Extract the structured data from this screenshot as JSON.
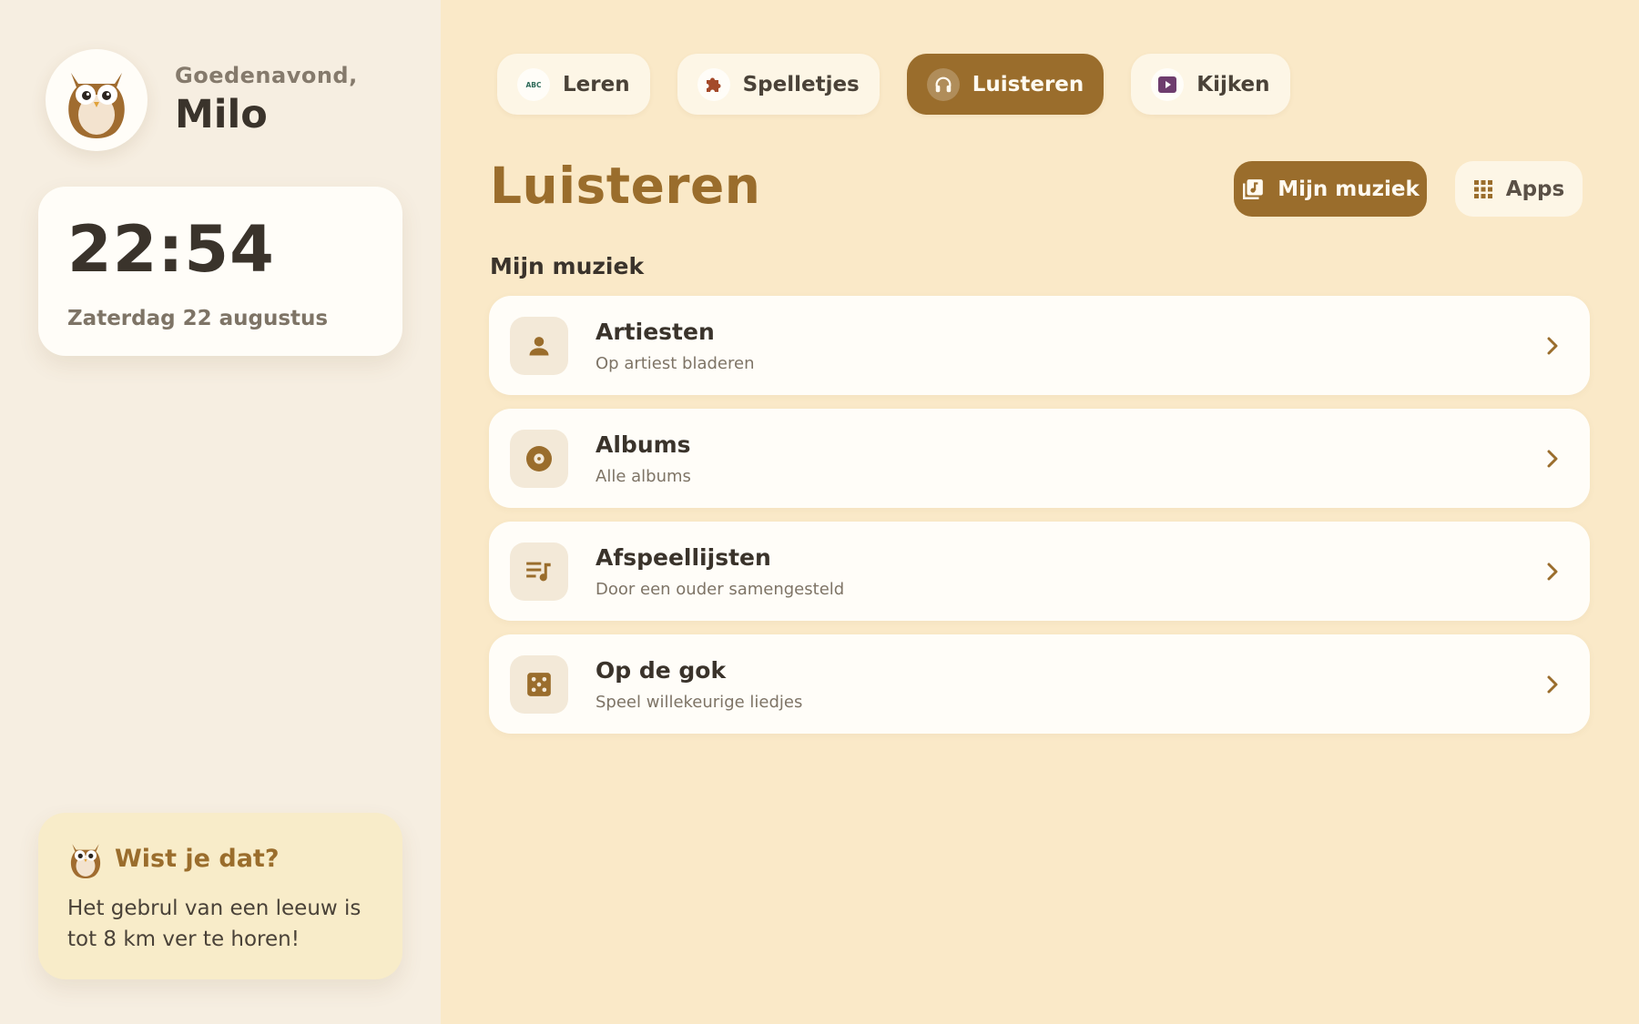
{
  "profile": {
    "greeting": "Goedenavond,",
    "name": "Milo"
  },
  "clock": {
    "time": "22:54",
    "date": "Zaterdag 22 augustus"
  },
  "fact": {
    "title": "Wist je dat?",
    "text": "Het gebrul van een leeuw is tot 8 km ver te horen!"
  },
  "tabs": [
    {
      "label": "Leren",
      "icon": "abc-icon",
      "active": false
    },
    {
      "label": "Spelletjes",
      "icon": "puzzle-icon",
      "active": false
    },
    {
      "label": "Luisteren",
      "icon": "headphones-icon",
      "active": true
    },
    {
      "label": "Kijken",
      "icon": "play-video-icon",
      "active": false
    }
  ],
  "header": {
    "title": "Luisteren",
    "primary_button": "Mijn muziek",
    "secondary_button": "Apps"
  },
  "section": {
    "title": "Mijn muziek"
  },
  "items": [
    {
      "title": "Artiesten",
      "subtitle": "Op artiest bladeren",
      "icon": "person-icon"
    },
    {
      "title": "Albums",
      "subtitle": "Alle albums",
      "icon": "disc-icon"
    },
    {
      "title": "Afspeellijsten",
      "subtitle": "Door een ouder samengesteld",
      "icon": "playlist-icon"
    },
    {
      "title": "Op de gok",
      "subtitle": "Speel willekeurige liedjes",
      "icon": "dice-icon"
    }
  ],
  "colors": {
    "accent": "#9a6d2c",
    "background": "#fae9c8",
    "sidebar": "#f6eee1",
    "card": "#fffdf8"
  }
}
